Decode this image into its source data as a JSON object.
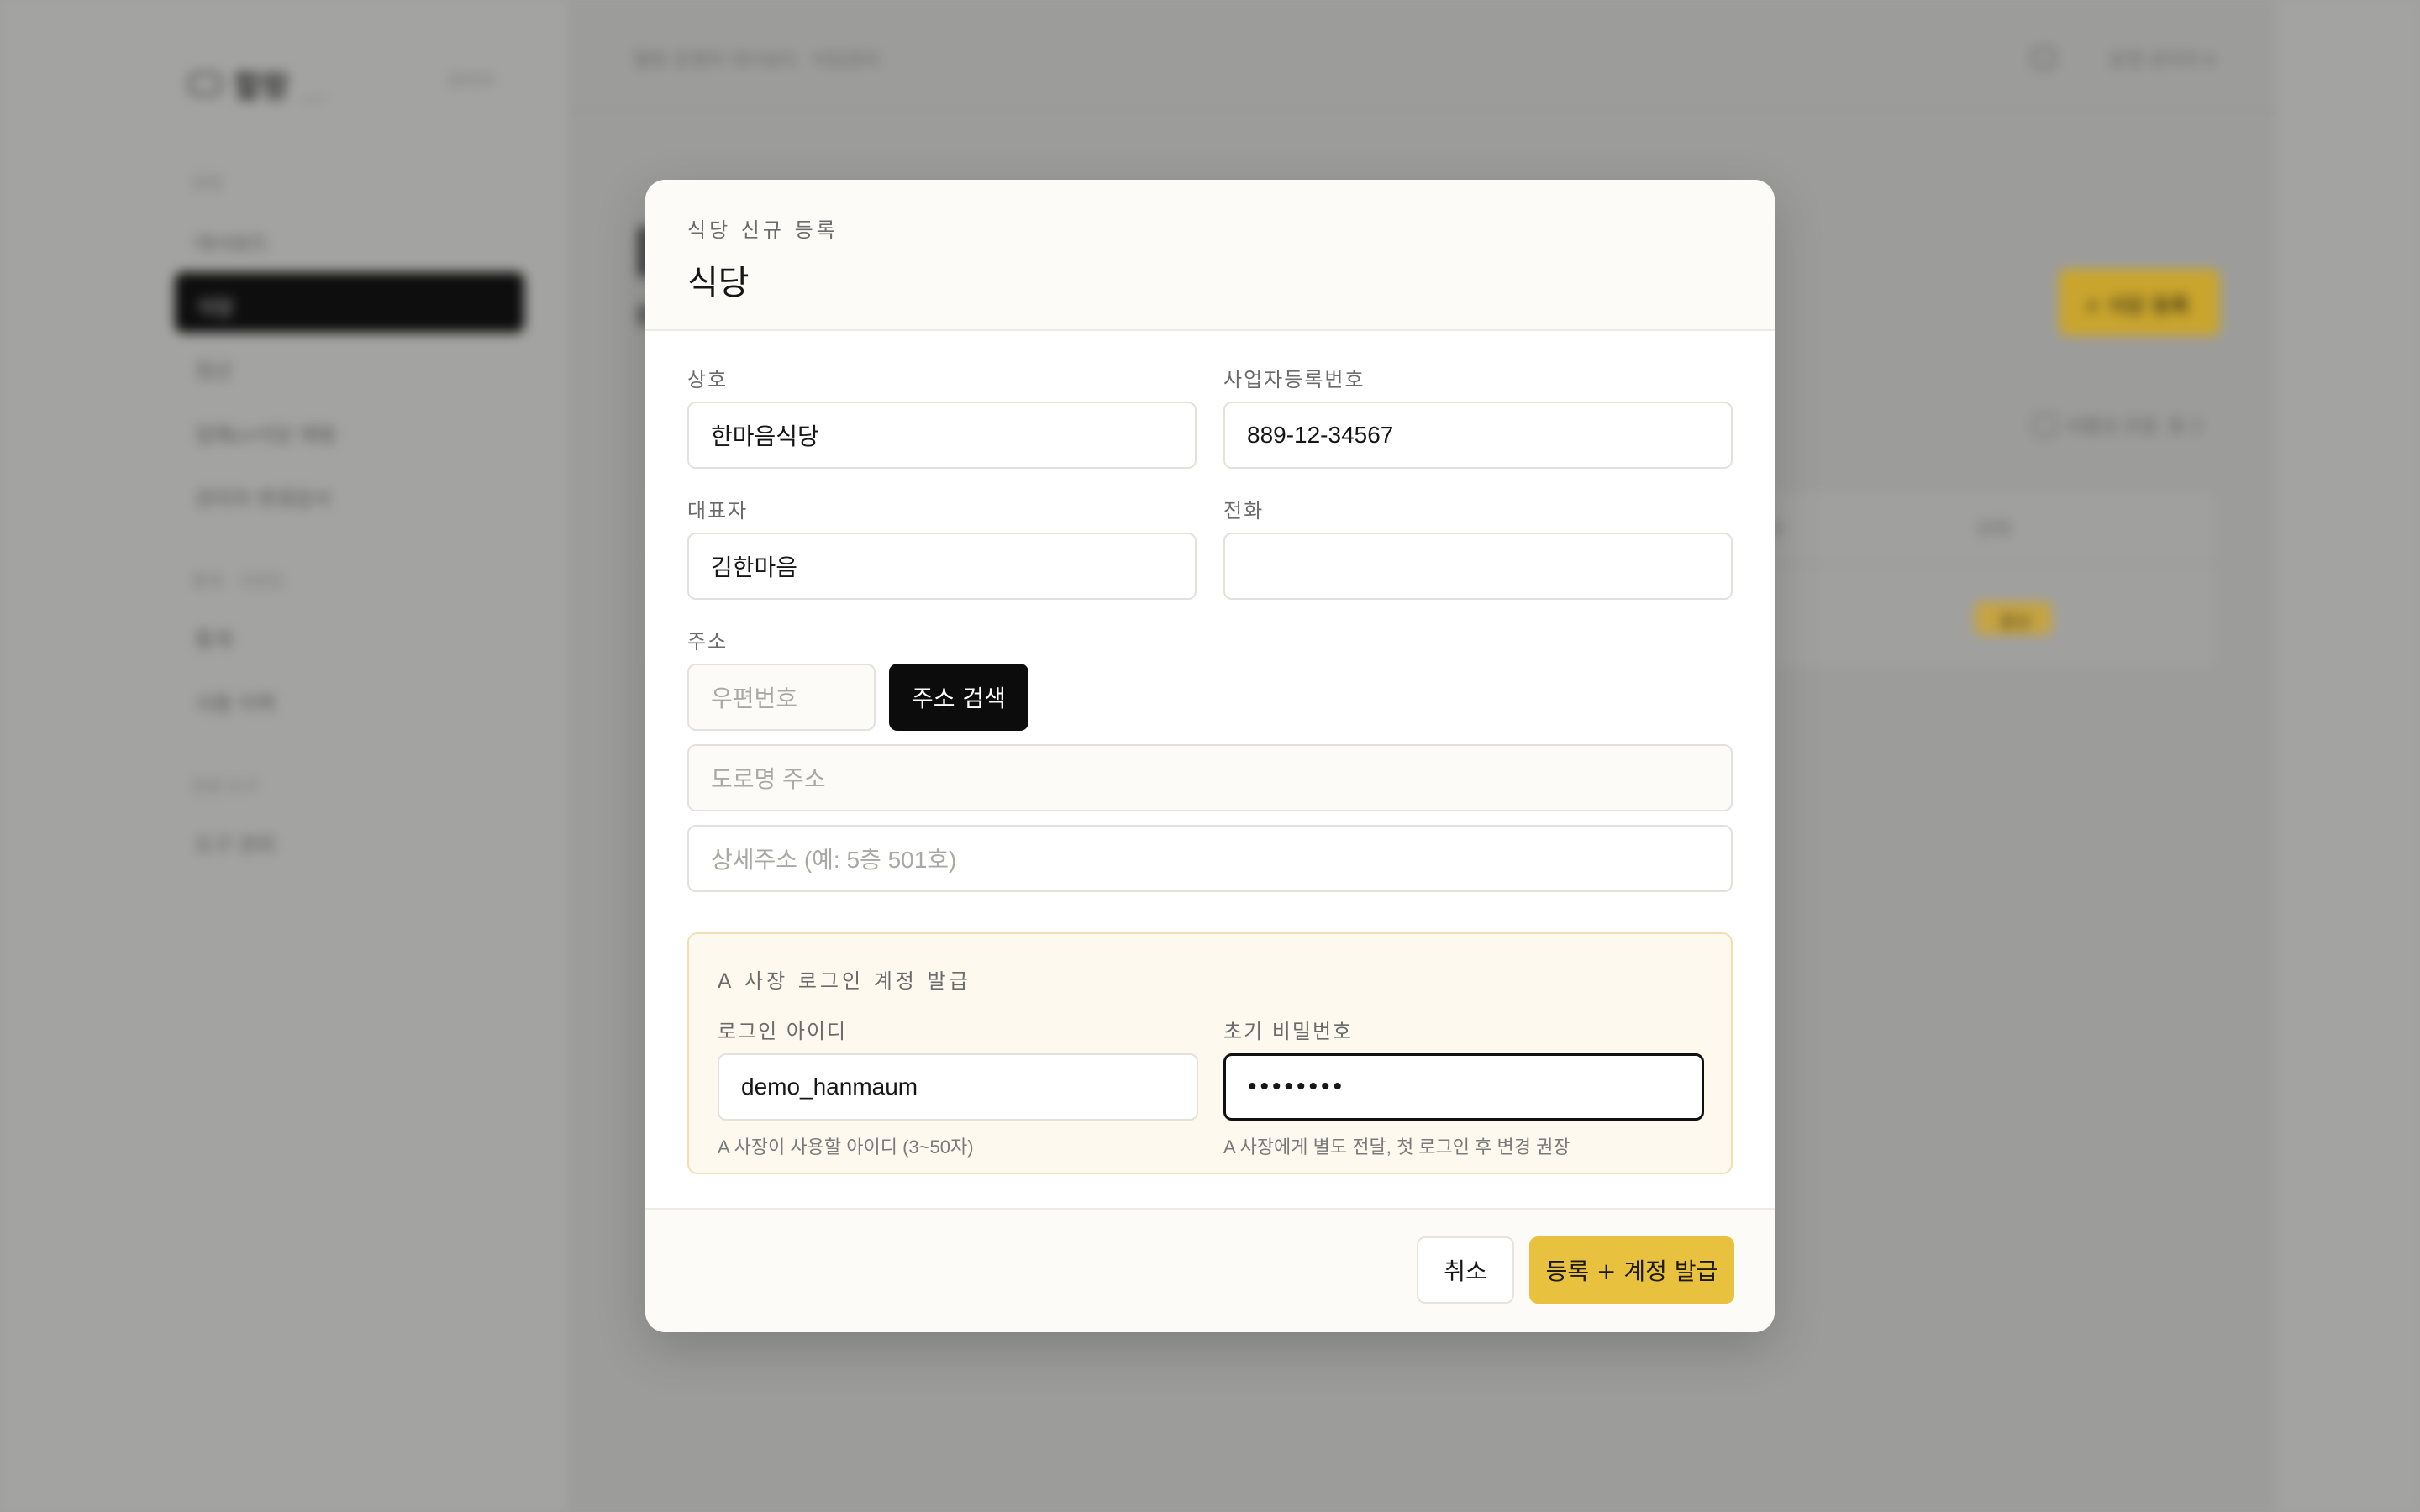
{
  "background": {
    "logo": {
      "name": "할랑",
      "sub": "___",
      "right": "관리자"
    },
    "nav": {
      "section_1": "운영",
      "items_1": [
        "대시보드",
        "식당",
        "정산",
        "업체cn식당 매핑",
        "관리자 변경감사"
      ],
      "section_2": "통계 · 리포트",
      "items_2": [
        "통계",
        "사용 이력"
      ],
      "section_3": "운영 도구",
      "items_3": [
        "도구 관리"
      ]
    },
    "crumbs": [
      "할랑 운영자 대시보드",
      "식당관리"
    ],
    "top_user": "운영 관리자 ▾",
    "add_button": "+ 식당 등록",
    "filter_label": "비활성 포함",
    "filter_extra": "총 2",
    "table_headers": [
      "식당",
      "상태"
    ],
    "badge": "활성"
  },
  "modal": {
    "eyebrow": "식당 신규 등록",
    "title": "식당",
    "fields": {
      "shop_name": {
        "label": "상호",
        "value": "한마음식당"
      },
      "biz_no": {
        "label": "사업자등록번호",
        "value": "889-12-34567"
      },
      "owner": {
        "label": "대표자",
        "value": "김한마음"
      },
      "phone": {
        "label": "전화",
        "value": ""
      },
      "address": {
        "label": "주소",
        "zip_placeholder": "우편번호",
        "search_button": "주소 검색",
        "road_placeholder": "도로명 주소",
        "detail_placeholder": "상세주소 (예: 5층 501호)"
      }
    },
    "account": {
      "title": "A 사장 로그인 계정 발급",
      "login_id": {
        "label": "로그인 아이디",
        "value": "demo_hanmaum",
        "hint": "A 사장이 사용할 아이디 (3~50자)"
      },
      "password": {
        "label": "초기 비밀번호",
        "value": "••••••••",
        "hint": "A 사장에게 별도 전달, 첫 로그인 후 변경 권장"
      }
    },
    "footer": {
      "cancel": "취소",
      "submit": "등록 + 계정 발급"
    }
  },
  "colors": {
    "accent": "#e8c23f",
    "overlay": "#9f9f9e",
    "primary_dark": "#0c0c0c",
    "account_bg": "#fdf9ef",
    "account_border": "#f0dfb4"
  }
}
